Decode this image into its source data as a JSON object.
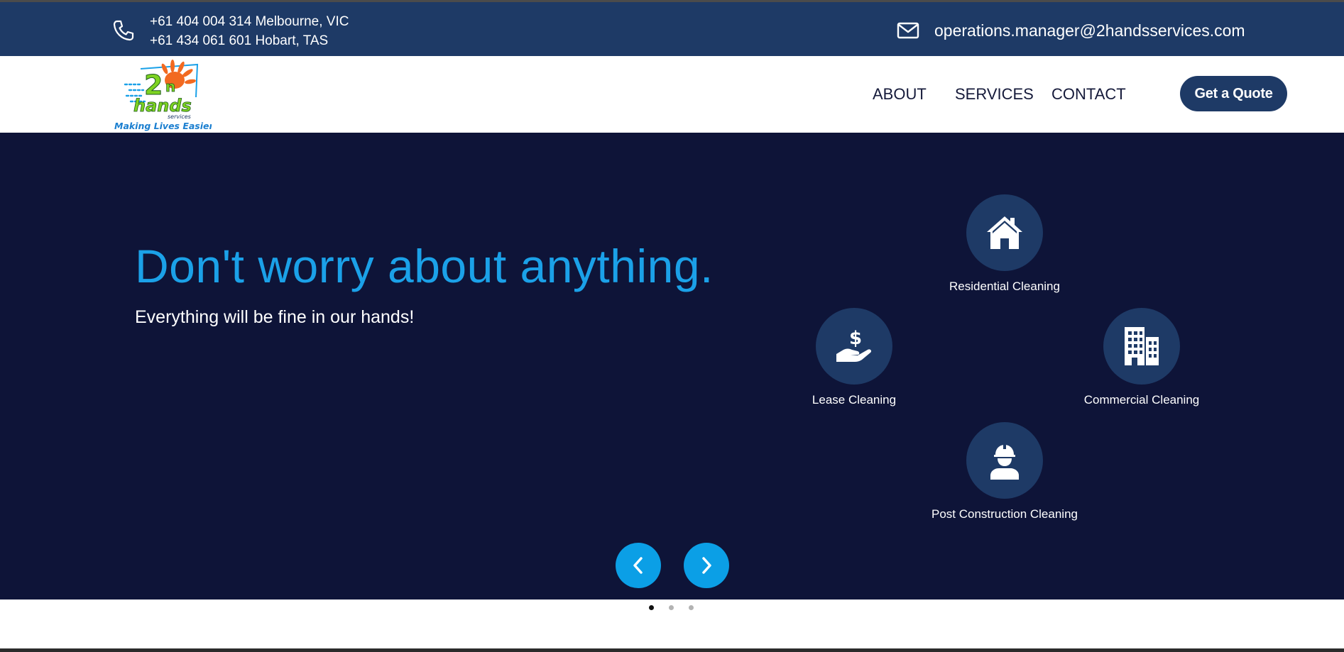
{
  "topbar": {
    "phone_line_1": "+61 404 004 314 Melbourne, VIC",
    "phone_line_2": "+61 434 061 601 Hobart, TAS",
    "email": "operations.manager@2handsservices.com",
    "phone_icon": "phone-icon",
    "mail_icon": "mail-icon"
  },
  "brand": {
    "logo_text_top": "2",
    "logo_text_small": "n",
    "logo_text_main": "hands",
    "logo_services": "services",
    "tagline": "Making Lives Easier"
  },
  "nav": {
    "items": [
      {
        "label": "ABOUT"
      },
      {
        "label": "SERVICES"
      },
      {
        "label": "CONTACT"
      }
    ],
    "cta_label": "Get a Quote"
  },
  "hero": {
    "headline": "Don't worry about anything.",
    "subline": "Everything will be fine in our hands!"
  },
  "services": [
    {
      "label": "Residential Cleaning",
      "icon": "house-icon"
    },
    {
      "label": "Lease Cleaning",
      "icon": "hand-dollar-icon"
    },
    {
      "label": "Commercial Cleaning",
      "icon": "building-icon"
    },
    {
      "label": "Post Construction Cleaning",
      "icon": "worker-icon"
    }
  ],
  "carousel": {
    "slides": 3,
    "active_slide": 1
  },
  "colors": {
    "topbar": "#1e3a66",
    "hero_bg": "#0e1438",
    "accent_blue": "#1ba1e8",
    "arrow_blue": "#0b9fe6",
    "logo_orange": "#f26a21",
    "logo_green": "#7ed321"
  }
}
